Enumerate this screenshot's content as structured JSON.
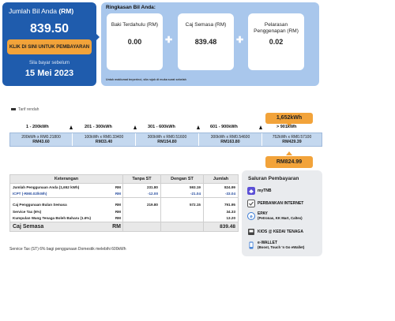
{
  "amount_card": {
    "label": "Jumlah Bil Anda",
    "currency": "(RM)",
    "amount": "839.50",
    "pay_button": "KLIK DI SINI UNTUK PEMBAYARAN",
    "due_label": "Sila bayar sebelum",
    "due_date": "15 Mei 2023"
  },
  "summary": {
    "title": "Ringkasan Bil Anda:",
    "boxes": [
      {
        "label": "Baki Terdahulu (RM)",
        "value": "0.00"
      },
      {
        "label": "Caj Semasa (RM)",
        "value": "839.48"
      },
      {
        "label": "Pelarasan Penggenapan (RM)",
        "value": "0.02"
      }
    ],
    "note": "Untuk maklumat terperinci, sila rujuk di muka surat sebelah"
  },
  "usage": {
    "usage_pill": "1,652kWh",
    "legend_stub": "Tarif rendah",
    "tiers": [
      {
        "header": "1 - 200kWh",
        "rate": "200kWh x RM0.21800",
        "amount": "RM43.60"
      },
      {
        "header": "201 - 300kWh",
        "rate": "100kWh x RM0.33400",
        "amount": "RM33.40"
      },
      {
        "header": "301 - 600kWh",
        "rate": "300kWh x RM0.51600",
        "amount": "RM154.80"
      },
      {
        "header": "601 - 900kWh",
        "rate": "300kWh x RM0.54600",
        "amount": "RM163.80"
      },
      {
        "header": "> 901kWh",
        "rate": "752kWh x RM0.57100",
        "amount": "RM429.39"
      }
    ],
    "total_pill": "RM824.99"
  },
  "breakdown": {
    "headers": [
      "Keterangan",
      "Tanpa ST",
      "Dengan ST",
      "Jumlah"
    ],
    "rows": [
      {
        "desc": "Jumlah Penggunaan Anda (1,652 kWh)",
        "rm": "RM",
        "tanpa": "231.80",
        "dengan": "593.19",
        "jumlah": "824.99"
      },
      {
        "desc": "ICPT (-RM0.02/kWh)",
        "rm": "RM",
        "tanpa": "-12.00",
        "dengan": "-21.04",
        "jumlah": "-33.04"
      },
      {
        "desc": "Caj Penggunaan Bulan Semasa",
        "rm": "RM",
        "tanpa": "219.80",
        "dengan": "572.15",
        "jumlah": "791.95"
      },
      {
        "desc": "Service Tax (6%)",
        "rm": "RM",
        "tanpa": "",
        "dengan": "",
        "jumlah": "34.33"
      },
      {
        "desc": "Kumpulan Wang Tenaga Boleh Baharu (1.6%)",
        "rm": "RM",
        "tanpa": "",
        "dengan": "",
        "jumlah": "13.20"
      }
    ],
    "total": {
      "desc": "Caj Semasa",
      "rm": "RM",
      "jumlah": "839.48"
    },
    "note": "Service Tax (ST) 6% bagi penggunaan Domestik melebihi 600kWh"
  },
  "channels": {
    "title": "Saluran Pembayaran",
    "items": [
      {
        "name": "myTNB",
        "sub": "",
        "icon": "mytnb-app-icon",
        "color": "#5b4fd6"
      },
      {
        "name": "PERBANKAN INTERNET",
        "sub": "",
        "icon": "internet-banking-icon",
        "color": "#6a6a6a"
      },
      {
        "name": "EPAY",
        "sub": "(Petronas, KK Mart, Caltex)",
        "icon": "epay-icon",
        "color": "#3a7bd5"
      },
      {
        "name": "KIOS @ KEDAI TENAGA",
        "sub": "",
        "icon": "kiosk-icon",
        "color": "#444444"
      },
      {
        "name": "e-WALLET",
        "sub": "(Boost, Touch 'n Go eWallet)",
        "icon": "ewallet-icon",
        "color": "#3a7bd5"
      }
    ]
  },
  "colors": {
    "brand_blue": "#1f5cad",
    "summary_bg": "#a9c7ec",
    "accent_orange": "#f2a33a"
  }
}
